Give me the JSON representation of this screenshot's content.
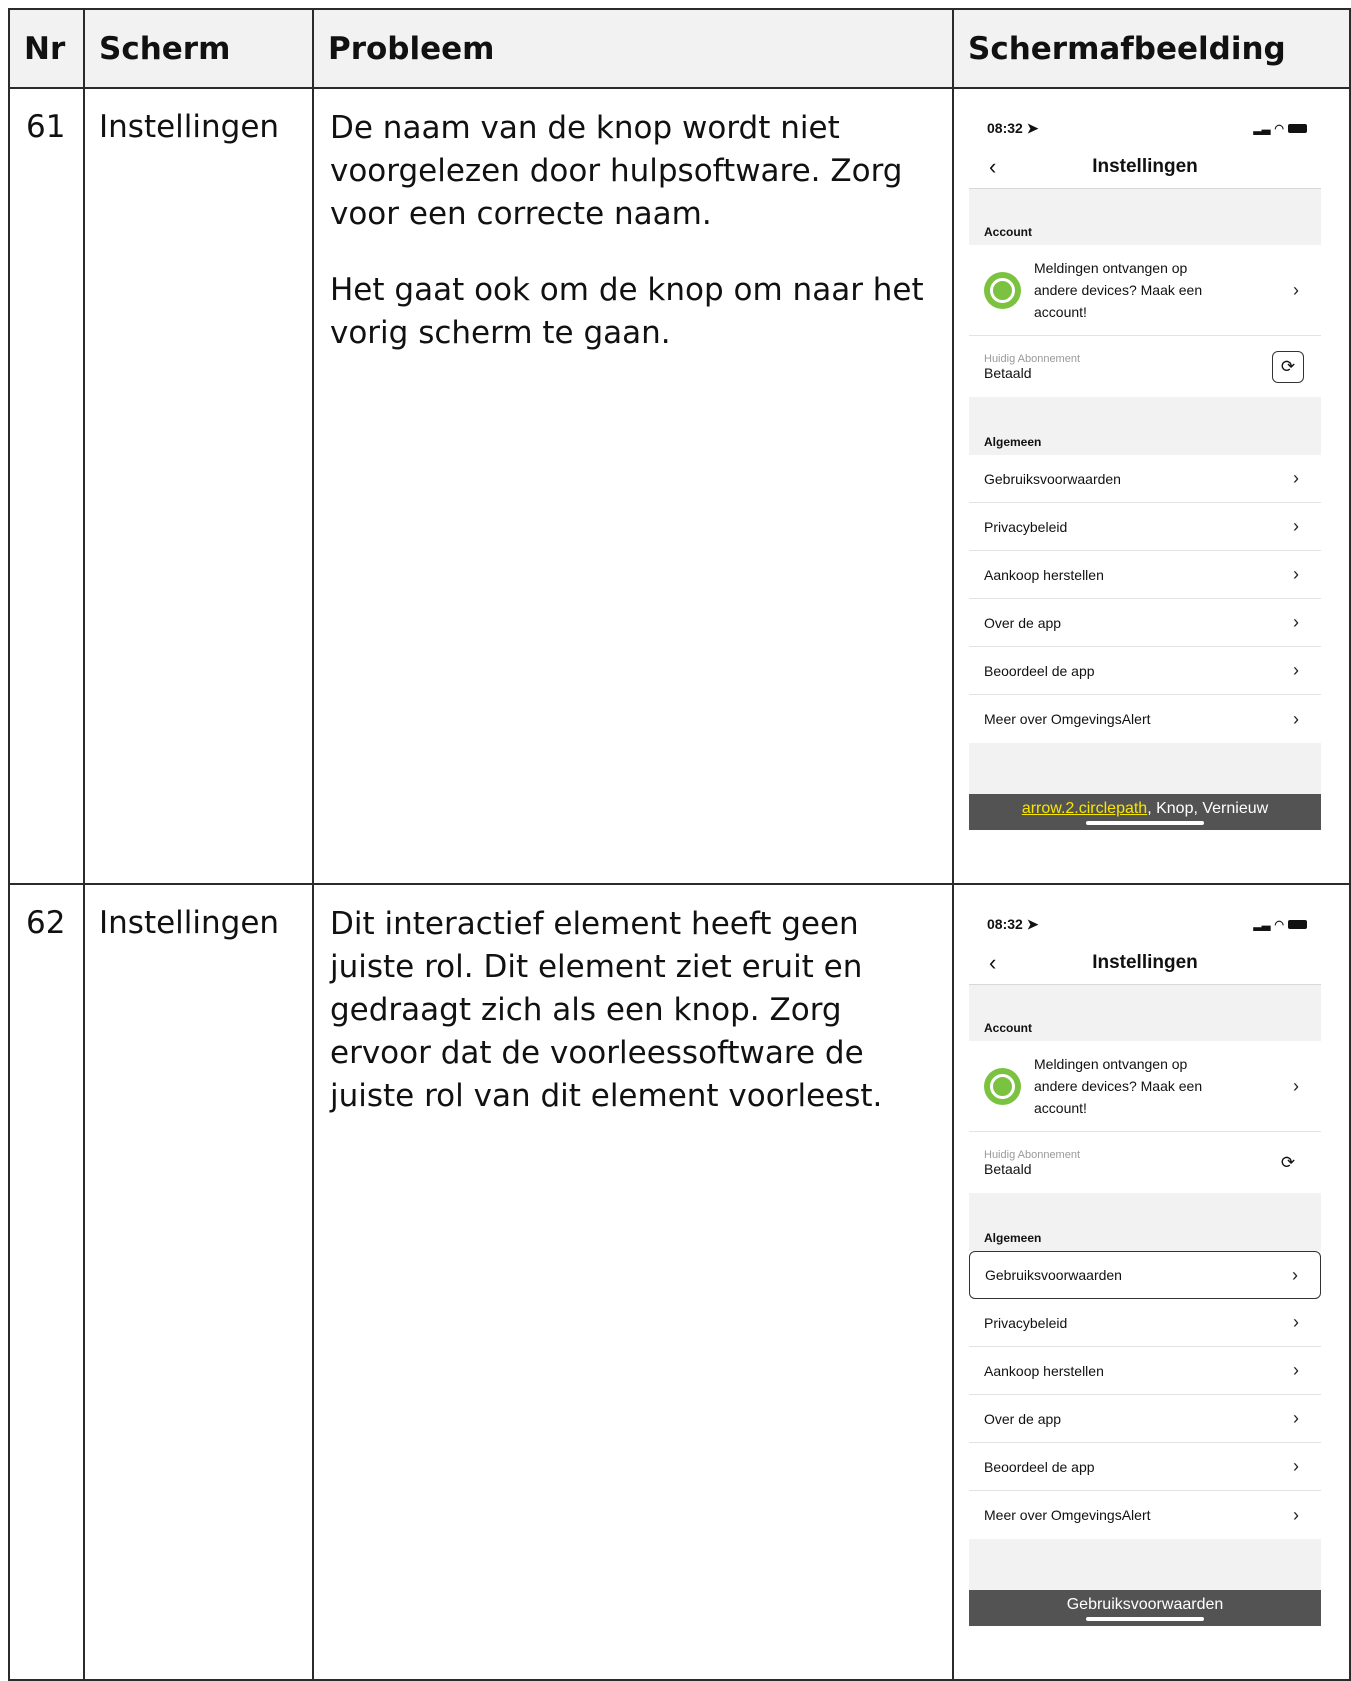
{
  "headers": {
    "nr": "Nr",
    "scherm": "Scherm",
    "probleem": "Probleem",
    "schermafbeelding": "Schermafbeelding"
  },
  "rows": [
    {
      "nr": "61",
      "scherm": "Instellingen",
      "probleem": [
        "De naam van de knop wordt niet voorgelezen door hulpsoftware. Zorg voor een correcte naam.",
        "Het gaat ook om de knop om naar het vorig scherm te gaan."
      ],
      "caption_highlight": "arrow.2.circlepath",
      "caption_rest": ", Knop, Vernieuw"
    },
    {
      "nr": "62",
      "scherm": "Instellingen",
      "probleem": [
        "Dit interactief element heeft geen juiste rol. Dit element ziet eruit en gedraagt zich als een knop. Zorg ervoor dat de voorleessoftware de juiste rol van dit element voorleest."
      ],
      "caption_highlight": "",
      "caption_rest": "Gebruiksvoorwaarden"
    }
  ],
  "phone": {
    "time": "08:32",
    "location_icon": "location-arrow-icon",
    "title": "Instellingen",
    "back_glyph": "‹",
    "section_account": "Account",
    "account_text": "Meldingen ontvangen op andere devices? Maak een account!",
    "abon_label": "Huidig Abonnement",
    "abon_value": "Betaald",
    "section_algemeen": "Algemeen",
    "items": [
      "Gebruiksvoorwaarden",
      "Privacybeleid",
      "Aankoop herstellen",
      "Over de app",
      "Beoordeel de app",
      "Meer over OmgevingsAlert"
    ],
    "chevron": "›",
    "refresh_glyph": "⟳",
    "avatar_color": "#7bc241"
  }
}
